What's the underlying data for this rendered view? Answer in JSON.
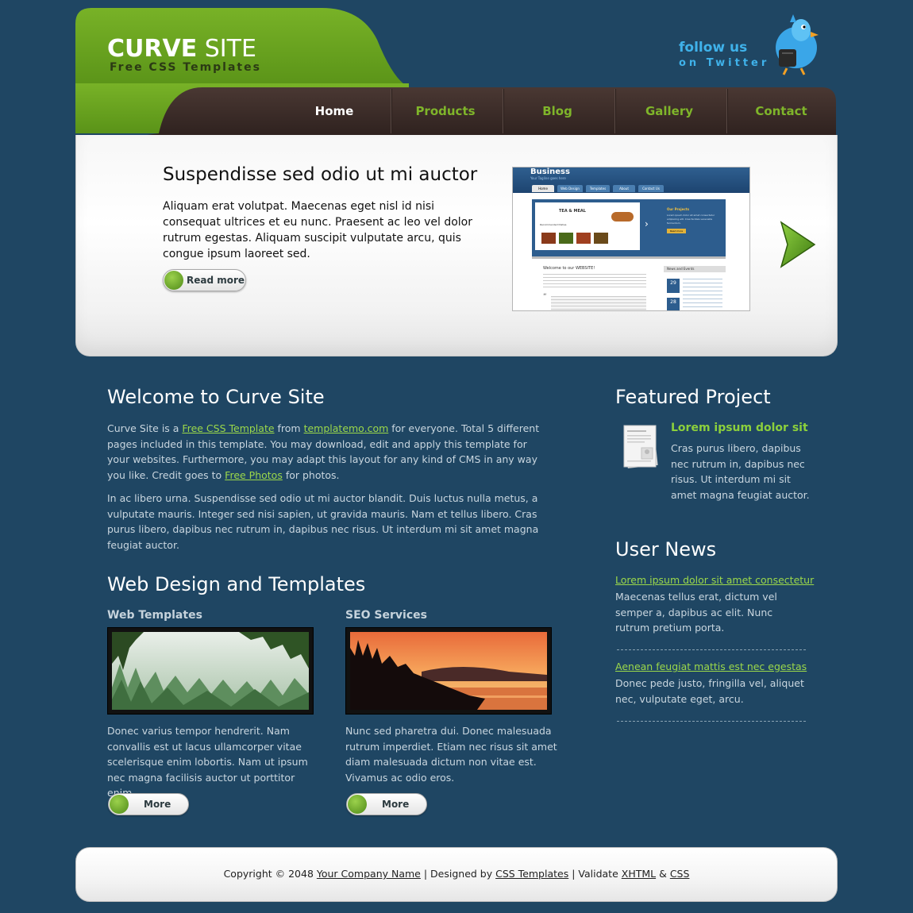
{
  "header": {
    "logo_main": "CURVE",
    "logo_rest": " SITE",
    "logo_sub": "Free CSS Templates",
    "twitter_line1": "follow us",
    "twitter_line2": "on Twitter"
  },
  "nav": {
    "items": [
      {
        "label": "Home",
        "active": true
      },
      {
        "label": "Products",
        "active": false
      },
      {
        "label": "Blog",
        "active": false
      },
      {
        "label": "Gallery",
        "active": false
      },
      {
        "label": "Contact",
        "active": false
      }
    ]
  },
  "hero": {
    "title": "Suspendisse sed odio ut mi auctor",
    "text": "Aliquam erat volutpat. Maecenas eget nisl id nisi consequat ultrices et eu nunc. Praesent ac leo vel dolor rutrum egestas. Aliquam suscipit vulputate arcu, quis congue ipsum laoreet sed.",
    "button_label": "Read more",
    "preview": {
      "brand": "Business",
      "tagline": "Your Tagline goes here",
      "tabs": [
        "Home",
        "Web Design",
        "Templates",
        "About",
        "Contact Us"
      ],
      "banner_title": "TEA & MEAL",
      "banner_caption": "Recommended Dishes",
      "projects_title": "Our Projects",
      "projects_text": "Lorem ipsum dolor sit amet consectetur adipiscing elit. Cras facilisis venenatis fermentum.",
      "read_more": "Read more",
      "welcome": "Welcome to our WEBSITE!",
      "news_title": "News and Events",
      "dates": [
        "29",
        "28"
      ],
      "date_month": "OCT"
    }
  },
  "welcome": {
    "title": "Welcome to Curve Site",
    "p1_a": "Curve Site is a ",
    "p1_link1": "Free CSS Template",
    "p1_b": " from ",
    "p1_link2": "templatemo.com",
    "p1_c": " for everyone. Total 5 different pages included in this template. You may download, edit and apply this template for your websites. Furthermore, you may adapt this layout for any kind of CMS in any way you like. Credit goes to ",
    "p1_link3": "Free Photos",
    "p1_d": " for photos.",
    "p2": "In ac libero urna. Suspendisse sed odio ut mi auctor blandit. Duis luctus nulla metus, a vulputate mauris. Integer sed nisi sapien, ut gravida mauris. Nam et tellus libero. Cras purus libero, dapibus nec rutrum in, dapibus nec risus. Ut interdum mi sit amet magna feugiat auctor."
  },
  "webdesign": {
    "title": "Web Design and Templates",
    "col1": {
      "heading": "Web Templates",
      "text": "Donec varius tempor hendrerit. Nam convallis est ut lacus ullamcorper vitae scelerisque enim lobortis. Nam ut ipsum nec magna facilisis auctor ut porttitor enim.",
      "button": "More"
    },
    "col2": {
      "heading": "SEO Services",
      "text": "Nunc sed pharetra dui. Donec malesuada rutrum imperdiet. Etiam nec risus sit amet diam malesuada dictum non vitae est. Vivamus ac odio eros.",
      "button": "More"
    }
  },
  "featured": {
    "title": "Featured Project",
    "heading": "Lorem ipsum dolor sit",
    "text": "Cras purus libero, dapibus nec rutrum in, dapibus nec risus. Ut interdum mi sit amet magna feugiat auctor."
  },
  "news": {
    "title": "User News",
    "items": [
      {
        "link": "Lorem ipsum dolor sit amet consectetur",
        "text": "Maecenas tellus erat, dictum vel semper a, dapibus ac elit. Nunc rutrum pretium porta."
      },
      {
        "link": "Aenean feugiat mattis est nec egestas",
        "text": "Donec pede justo, fringilla vel, aliquet nec, vulputate eget, arcu."
      }
    ]
  },
  "footer": {
    "copyright": "Copyright © 2048 ",
    "company": "Your Company Name",
    "sep1": " | Designed by ",
    "designer": "CSS Templates",
    "sep2": " | Validate ",
    "xhtml": "XHTML",
    "amp": " & ",
    "css": "CSS"
  },
  "colors": {
    "background": "#1f4663",
    "brand_green": "#6aa31f",
    "nav_brown": "#3b2b27",
    "link_green": "#9bd84a",
    "twitter_blue": "#3fb2ea"
  }
}
